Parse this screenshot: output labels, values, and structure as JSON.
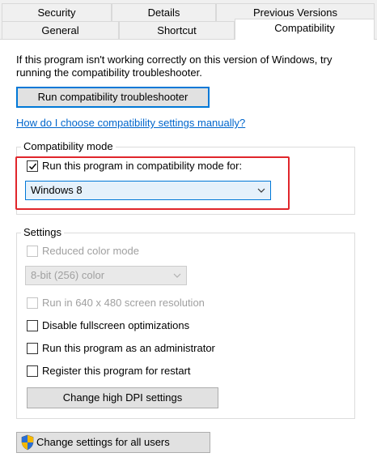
{
  "tabs_row1": [
    {
      "label": "Security"
    },
    {
      "label": "Details"
    },
    {
      "label": "Previous Versions"
    }
  ],
  "tabs_row2": [
    {
      "label": "General"
    },
    {
      "label": "Shortcut"
    },
    {
      "label": "Compatibility"
    }
  ],
  "intro_text": "If this program isn't working correctly on this version of Windows, try running the compatibility troubleshooter.",
  "troubleshooter_button": "Run compatibility troubleshooter",
  "manual_link": "How do I choose compatibility settings manually?",
  "compat_mode": {
    "group_label": "Compatibility mode",
    "checkbox_label": "Run this program in compatibility mode for:",
    "checked": true,
    "selected_os": "Windows 8",
    "highlight_color": "#e0262b"
  },
  "settings": {
    "group_label": "Settings",
    "reduced_color": "Reduced color mode",
    "color_depth": "8-bit (256) color",
    "res_640": "Run in 640 x 480 screen resolution",
    "disable_fullscreen": "Disable fullscreen optimizations",
    "run_as_admin": "Run this program as an administrator",
    "register_restart": "Register this program for restart",
    "dpi_button": "Change high DPI settings"
  },
  "all_users_button": "Change settings for all users",
  "icons": {
    "shield": "uac-shield-icon",
    "chevron": "chevron-down-icon",
    "check": "checkmark-icon"
  }
}
